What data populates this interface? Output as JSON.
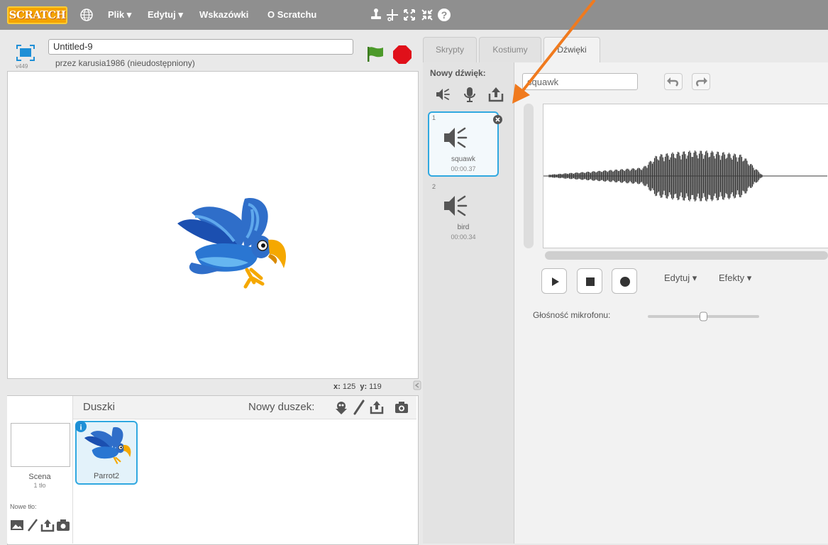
{
  "app": {
    "logo_text": "SCRATCH",
    "menu": {
      "file": "Plik ▾",
      "edit": "Edytuj ▾",
      "tips": "Wskazówki",
      "about": "O Scratchu"
    },
    "toolbar_icons": [
      "duplicate-stamp-icon",
      "delete-cut-icon",
      "grow-icon",
      "shrink-icon",
      "help-icon"
    ]
  },
  "project": {
    "title": "Untitled-9",
    "author": "przez karusia1986 (nieudostępniony)",
    "version": "v449"
  },
  "stage": {
    "coords": {
      "x_label": "x:",
      "x": "125",
      "y_label": "y:",
      "y": "119"
    }
  },
  "sprites": {
    "header": "Duszki",
    "new_sprite": "Nowy duszek:",
    "scene": {
      "label": "Scena",
      "count": "1 tło"
    },
    "new_backdrop": "Nowe tło:",
    "items": [
      {
        "name": "Parrot2",
        "selected": true
      }
    ]
  },
  "tabs": [
    {
      "label": "Skrypty",
      "active": false
    },
    {
      "label": "Kostiumy",
      "active": false
    },
    {
      "label": "Dźwięki",
      "active": true
    }
  ],
  "sounds": {
    "new_sound": "Nowy dźwięk:",
    "items": [
      {
        "num": "1",
        "name": "squawk",
        "duration": "00:00.37",
        "selected": true
      },
      {
        "num": "2",
        "name": "bird",
        "duration": "00:00.34",
        "selected": false
      }
    ]
  },
  "editor": {
    "sound_name": "squawk",
    "edit_menu": "Edytuj ▾",
    "effects_menu": "Efekty ▾",
    "mic_label": "Głośność mikrofonu:",
    "mic_level": 0.5
  },
  "colors": {
    "topbar": "#8f8f8f",
    "logo": "#f4a300",
    "selection": "#30a8e0",
    "flag": "#4c9a2a",
    "stop": "#e0101a",
    "annotation_arrow": "#f07a1e"
  }
}
